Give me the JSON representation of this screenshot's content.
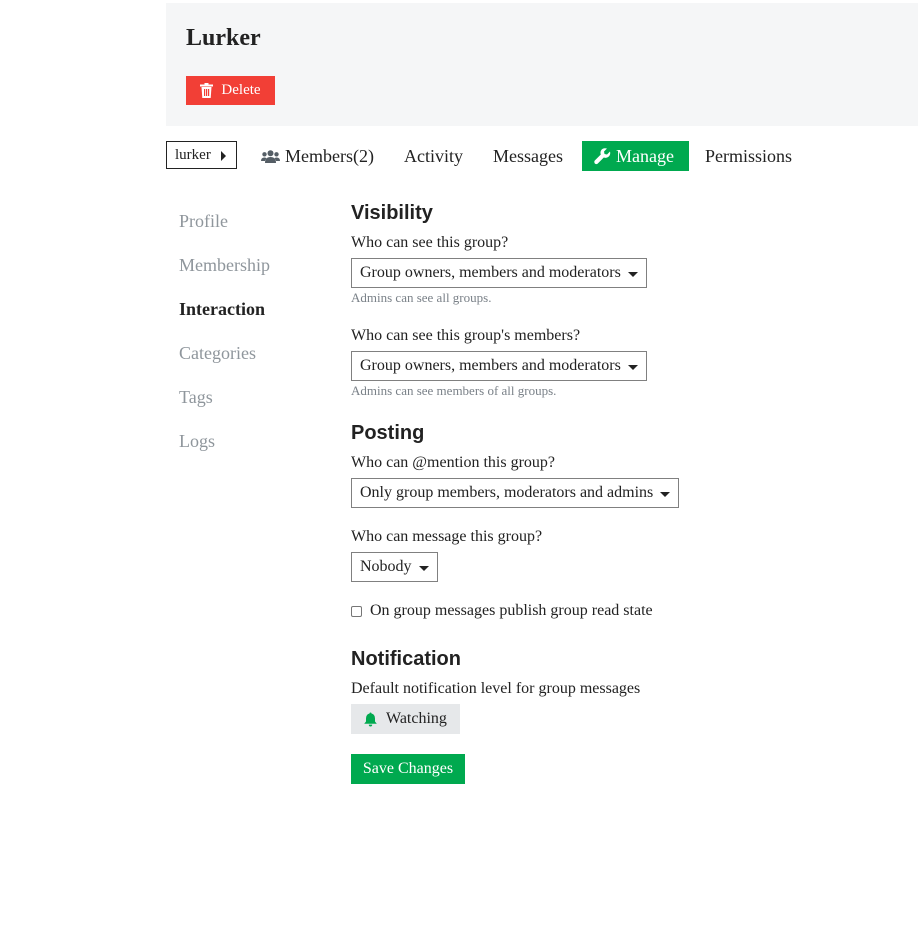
{
  "header": {
    "title": "Lurker",
    "delete_label": "Delete"
  },
  "nav": {
    "group_selector": "lurker",
    "tabs": [
      {
        "label": "Members(2)",
        "icon": "users-icon"
      },
      {
        "label": "Activity"
      },
      {
        "label": "Messages"
      },
      {
        "label": "Manage",
        "icon": "wrench-icon",
        "active": true
      },
      {
        "label": "Permissions"
      }
    ]
  },
  "sidebar": {
    "items": [
      {
        "label": "Profile"
      },
      {
        "label": "Membership"
      },
      {
        "label": "Interaction",
        "active": true
      },
      {
        "label": "Categories"
      },
      {
        "label": "Tags"
      },
      {
        "label": "Logs"
      }
    ]
  },
  "visibility": {
    "title": "Visibility",
    "see_group_label": "Who can see this group?",
    "see_group_value": "Group owners, members and moderators",
    "see_group_hint": "Admins can see all groups.",
    "see_members_label": "Who can see this group's members?",
    "see_members_value": "Group owners, members and moderators",
    "see_members_hint": "Admins can see members of all groups."
  },
  "posting": {
    "title": "Posting",
    "mention_label": "Who can @mention this group?",
    "mention_value": "Only group members, moderators and admins",
    "message_label": "Who can message this group?",
    "message_value": "Nobody",
    "read_state_label": "On group messages publish group read state",
    "read_state_checked": false
  },
  "notification": {
    "title": "Notification",
    "level_label": "Default notification level for group messages",
    "level_value": "Watching"
  },
  "save_label": "Save Changes",
  "colors": {
    "accent": "#00a94f",
    "danger": "#f23f36",
    "header_bg": "#f5f6f7",
    "muted": "#8f969c"
  }
}
